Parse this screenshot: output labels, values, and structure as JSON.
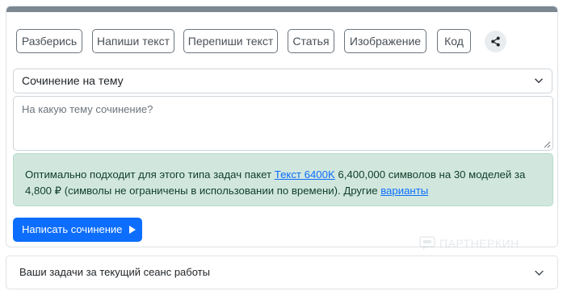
{
  "tabs": [
    {
      "label": "Разберись"
    },
    {
      "label": "Напиши текст"
    },
    {
      "label": "Перепиши текст"
    },
    {
      "label": "Статья"
    },
    {
      "label": "Изображение"
    },
    {
      "label": "Код"
    }
  ],
  "select": {
    "value": "Сочинение на тему"
  },
  "textarea": {
    "placeholder": "На какую тему сочинение?"
  },
  "alert": {
    "text_before": "Оптимально подходит для этого типа задач пакет ",
    "link_package": "Текст 6400K",
    "text_middle": " 6,400,000 символов на 30 моделей за 4,800 ₽ (символы не ограничены в использовании по времени). Другие ",
    "link_variants": "варианты"
  },
  "submit": {
    "label": "Написать сочинение"
  },
  "watermark": {
    "text": "ПАРТНЕРКИН"
  },
  "tasks_panel": {
    "title": "Ваши задачи за текущий сеанс работы"
  },
  "colors": {
    "primary": "#0d6efd",
    "alert_bg": "#d1e7dd",
    "topbar": "#7b8791"
  }
}
